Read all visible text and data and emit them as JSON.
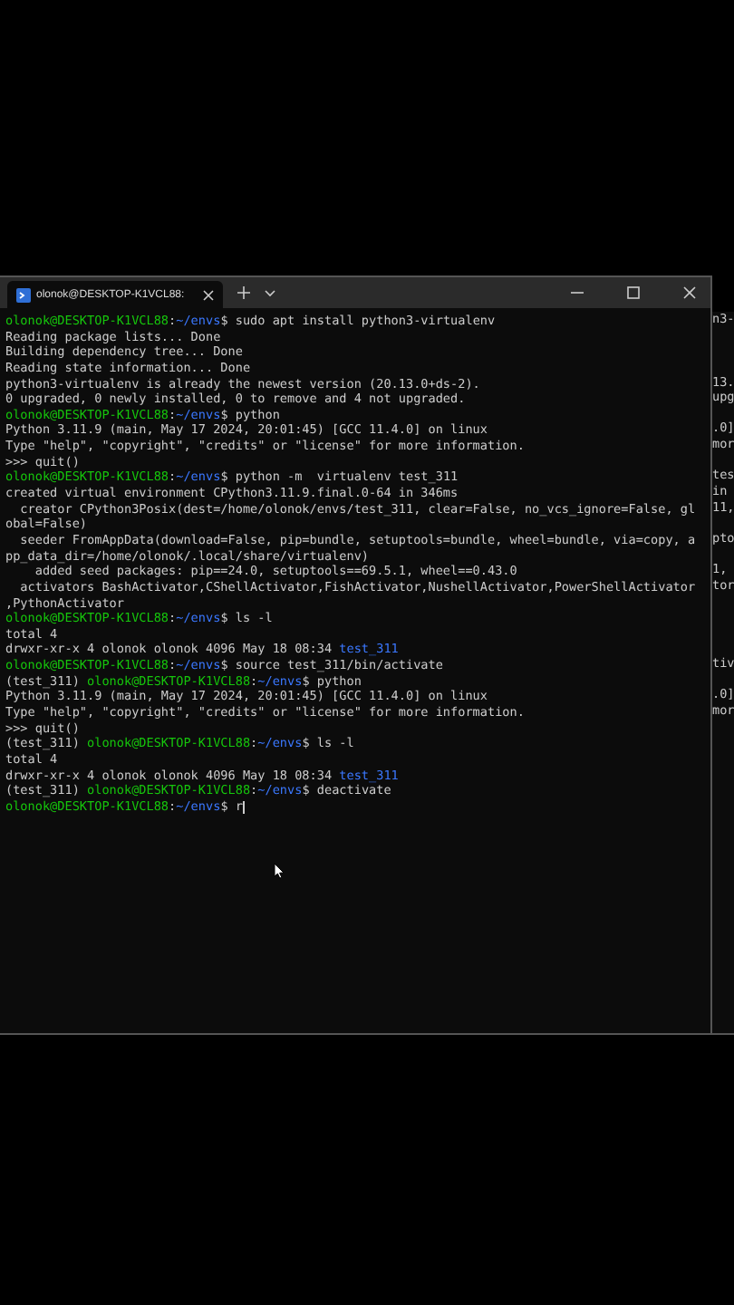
{
  "window": {
    "tab": {
      "title": "olonok@DESKTOP-K1VCL88: ",
      "selected": true
    }
  },
  "terminal": {
    "lines": [
      {
        "kind": "prompt",
        "background_text": "n3-",
        "segments": [
          {
            "kind": "user",
            "text": "olonok@DESKTOP-K1VCL88"
          },
          {
            "kind": "plain",
            "text": ":"
          },
          {
            "kind": "path",
            "text": "~/envs"
          },
          {
            "kind": "plain",
            "text": "$ sudo apt install python3-virtualenv"
          }
        ]
      },
      {
        "kind": "output",
        "segments": [
          {
            "kind": "plain",
            "text": "Reading package lists... Done"
          }
        ]
      },
      {
        "kind": "output",
        "segments": [
          {
            "kind": "plain",
            "text": "Building dependency tree... Done"
          }
        ]
      },
      {
        "kind": "output",
        "segments": [
          {
            "kind": "plain",
            "text": "Reading state information... Done"
          }
        ]
      },
      {
        "kind": "output",
        "background_text": "13.",
        "segments": [
          {
            "kind": "plain",
            "text": "python3-virtualenv is already the newest version (20.13.0+ds-2)."
          }
        ]
      },
      {
        "kind": "output",
        "background_text": "upg",
        "segments": [
          {
            "kind": "plain",
            "text": "0 upgraded, 0 newly installed, 0 to remove and 4 not upgraded."
          }
        ]
      },
      {
        "kind": "prompt",
        "segments": [
          {
            "kind": "user",
            "text": "olonok@DESKTOP-K1VCL88"
          },
          {
            "kind": "plain",
            "text": ":"
          },
          {
            "kind": "path",
            "text": "~/envs"
          },
          {
            "kind": "plain",
            "text": "$ python"
          }
        ]
      },
      {
        "kind": "output",
        "background_text": ".0]",
        "segments": [
          {
            "kind": "plain",
            "text": "Python 3.11.9 (main, May 17 2024, 20:01:45) [GCC 11.4.0] on linux"
          }
        ]
      },
      {
        "kind": "output",
        "background_text": "mor",
        "segments": [
          {
            "kind": "plain",
            "text": "Type \"help\", \"copyright\", \"credits\" or \"license\" for more information."
          }
        ]
      },
      {
        "kind": "output",
        "segments": [
          {
            "kind": "plain",
            "text": ">>> quit()"
          }
        ]
      },
      {
        "kind": "prompt",
        "background_text": "tes",
        "segments": [
          {
            "kind": "user",
            "text": "olonok@DESKTOP-K1VCL88"
          },
          {
            "kind": "plain",
            "text": ":"
          },
          {
            "kind": "path",
            "text": "~/envs"
          },
          {
            "kind": "plain",
            "text": "$ python -m  virtualenv test_311"
          }
        ]
      },
      {
        "kind": "output",
        "background_text": "in",
        "segments": [
          {
            "kind": "plain",
            "text": "created virtual environment CPython3.11.9.final.0-64 in 346ms"
          }
        ]
      },
      {
        "kind": "output",
        "background_text": "11,",
        "segments": [
          {
            "kind": "plain",
            "text": "  creator CPython3Posix(dest=/home/olonok/envs/test_311, clear=False, no_vcs_ignore=False, gl"
          }
        ]
      },
      {
        "kind": "output",
        "segments": [
          {
            "kind": "plain",
            "text": "obal=False)"
          }
        ]
      },
      {
        "kind": "output",
        "background_text": "pto",
        "segments": [
          {
            "kind": "plain",
            "text": "  seeder FromAppData(download=False, pip=bundle, setuptools=bundle, wheel=bundle, via=copy, a"
          }
        ]
      },
      {
        "kind": "output",
        "segments": [
          {
            "kind": "plain",
            "text": "pp_data_dir=/home/olonok/.local/share/virtualenv)"
          }
        ]
      },
      {
        "kind": "output",
        "background_text": "1,",
        "segments": [
          {
            "kind": "plain",
            "text": "    added seed packages: pip==24.0, setuptools==69.5.1, wheel==0.43.0"
          }
        ]
      },
      {
        "kind": "output",
        "background_text": "tor",
        "segments": [
          {
            "kind": "plain",
            "text": "  activators BashActivator,CShellActivator,FishActivator,NushellActivator,PowerShellActivator"
          }
        ]
      },
      {
        "kind": "output",
        "segments": [
          {
            "kind": "plain",
            "text": ",PythonActivator"
          }
        ]
      },
      {
        "kind": "prompt",
        "segments": [
          {
            "kind": "user",
            "text": "olonok@DESKTOP-K1VCL88"
          },
          {
            "kind": "plain",
            "text": ":"
          },
          {
            "kind": "path",
            "text": "~/envs"
          },
          {
            "kind": "plain",
            "text": "$ ls -l"
          }
        ]
      },
      {
        "kind": "output",
        "segments": [
          {
            "kind": "plain",
            "text": "total 4"
          }
        ]
      },
      {
        "kind": "output",
        "segments": [
          {
            "kind": "plain",
            "text": "drwxr-xr-x 4 olonok olonok 4096 May 18 08:34 "
          },
          {
            "kind": "dir",
            "text": "test_311"
          }
        ]
      },
      {
        "kind": "prompt",
        "background_text": "tiv",
        "segments": [
          {
            "kind": "user",
            "text": "olonok@DESKTOP-K1VCL88"
          },
          {
            "kind": "plain",
            "text": ":"
          },
          {
            "kind": "path",
            "text": "~/envs"
          },
          {
            "kind": "plain",
            "text": "$ source test_311/bin/activate"
          }
        ]
      },
      {
        "kind": "prompt",
        "segments": [
          {
            "kind": "plain",
            "text": "(test_311) "
          },
          {
            "kind": "user",
            "text": "olonok@DESKTOP-K1VCL88"
          },
          {
            "kind": "plain",
            "text": ":"
          },
          {
            "kind": "path",
            "text": "~/envs"
          },
          {
            "kind": "plain",
            "text": "$ python"
          }
        ]
      },
      {
        "kind": "output",
        "background_text": ".0]",
        "segments": [
          {
            "kind": "plain",
            "text": "Python 3.11.9 (main, May 17 2024, 20:01:45) [GCC 11.4.0] on linux"
          }
        ]
      },
      {
        "kind": "output",
        "background_text": "mor",
        "segments": [
          {
            "kind": "plain",
            "text": "Type \"help\", \"copyright\", \"credits\" or \"license\" for more information."
          }
        ]
      },
      {
        "kind": "output",
        "segments": [
          {
            "kind": "plain",
            "text": ">>> quit()"
          }
        ]
      },
      {
        "kind": "prompt",
        "segments": [
          {
            "kind": "plain",
            "text": "(test_311) "
          },
          {
            "kind": "user",
            "text": "olonok@DESKTOP-K1VCL88"
          },
          {
            "kind": "plain",
            "text": ":"
          },
          {
            "kind": "path",
            "text": "~/envs"
          },
          {
            "kind": "plain",
            "text": "$ ls -l"
          }
        ]
      },
      {
        "kind": "output",
        "segments": [
          {
            "kind": "plain",
            "text": "total 4"
          }
        ]
      },
      {
        "kind": "output",
        "segments": [
          {
            "kind": "plain",
            "text": "drwxr-xr-x 4 olonok olonok 4096 May 18 08:34 "
          },
          {
            "kind": "dir",
            "text": "test_311"
          }
        ]
      },
      {
        "kind": "prompt",
        "segments": [
          {
            "kind": "plain",
            "text": "(test_311) "
          },
          {
            "kind": "user",
            "text": "olonok@DESKTOP-K1VCL88"
          },
          {
            "kind": "plain",
            "text": ":"
          },
          {
            "kind": "path",
            "text": "~/envs"
          },
          {
            "kind": "plain",
            "text": "$ deactivate"
          }
        ]
      },
      {
        "kind": "input",
        "segments": [
          {
            "kind": "user",
            "text": "olonok@DESKTOP-K1VCL88"
          },
          {
            "kind": "plain",
            "text": ":"
          },
          {
            "kind": "path",
            "text": "~/envs"
          },
          {
            "kind": "plain",
            "text": "$ r"
          }
        ]
      }
    ]
  }
}
